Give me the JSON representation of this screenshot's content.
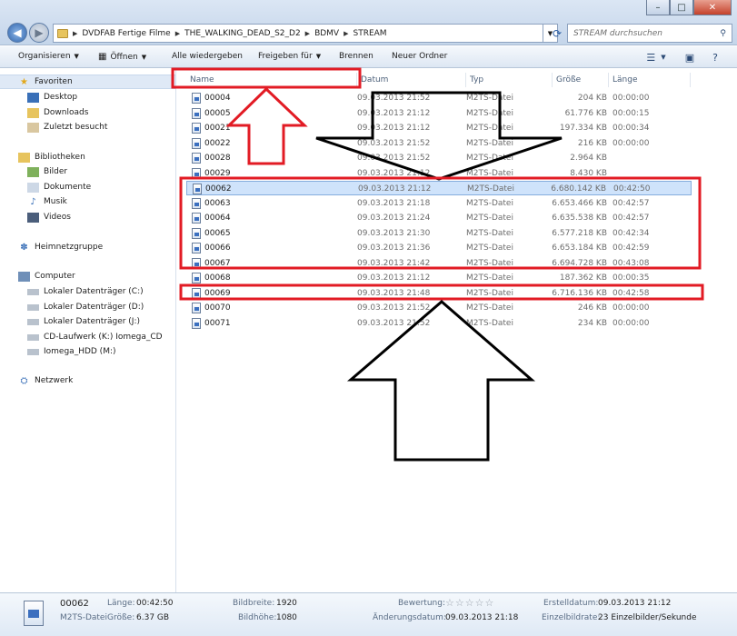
{
  "address": {
    "crumbs": [
      "DVDFAB Fertige Filme",
      "THE_WALKING_DEAD_S2_D2",
      "BDMV",
      "STREAM"
    ],
    "search_placeholder": "STREAM durchsuchen"
  },
  "toolbar": {
    "organize": "Organisieren",
    "open": "Öffnen",
    "play_all": "Alle wiedergeben",
    "share": "Freigeben für",
    "burn": "Brennen",
    "new_folder": "Neuer Ordner"
  },
  "nav": {
    "favorites": "Favoriten",
    "desktop": "Desktop",
    "downloads": "Downloads",
    "recent": "Zuletzt besucht",
    "libraries": "Bibliotheken",
    "pictures": "Bilder",
    "documents": "Dokumente",
    "music": "Musik",
    "videos": "Videos",
    "homegroup": "Heimnetzgruppe",
    "computer": "Computer",
    "drive_c": "Lokaler Datenträger (C:)",
    "drive_d": "Lokaler Datenträger (D:)",
    "drive_j": "Lokaler Datenträger (J:)",
    "drive_k": "CD-Laufwerk (K:) Iomega_CD",
    "drive_m": "Iomega_HDD (M:)",
    "network": "Netzwerk"
  },
  "columns": {
    "name": "Name",
    "date": "Datum",
    "type": "Typ",
    "size": "Größe",
    "length": "Länge"
  },
  "files": [
    {
      "name": "00004",
      "date": "09.03.2013 21:52",
      "type": "M2TS-Datei",
      "size": "204 KB",
      "length": "00:00:00"
    },
    {
      "name": "00005",
      "date": "09.03.2013 21:12",
      "type": "M2TS-Datei",
      "size": "61.776 KB",
      "length": "00:00:15"
    },
    {
      "name": "00021",
      "date": "09.03.2013 21:12",
      "type": "M2TS-Datei",
      "size": "197.334 KB",
      "length": "00:00:34"
    },
    {
      "name": "00022",
      "date": "09.03.2013 21:52",
      "type": "M2TS-Datei",
      "size": "216 KB",
      "length": "00:00:00"
    },
    {
      "name": "00028",
      "date": "09.03.2013 21:52",
      "type": "M2TS-Datei",
      "size": "2.964 KB",
      "length": ""
    },
    {
      "name": "00029",
      "date": "09.03.2013 21:12",
      "type": "M2TS-Datei",
      "size": "8.430 KB",
      "length": ""
    },
    {
      "name": "00062",
      "date": "09.03.2013 21:12",
      "type": "M2TS-Datei",
      "size": "6.680.142 KB",
      "length": "00:42:50"
    },
    {
      "name": "00063",
      "date": "09.03.2013 21:18",
      "type": "M2TS-Datei",
      "size": "6.653.466 KB",
      "length": "00:42:57"
    },
    {
      "name": "00064",
      "date": "09.03.2013 21:24",
      "type": "M2TS-Datei",
      "size": "6.635.538 KB",
      "length": "00:42:57"
    },
    {
      "name": "00065",
      "date": "09.03.2013 21:30",
      "type": "M2TS-Datei",
      "size": "6.577.218 KB",
      "length": "00:42:34"
    },
    {
      "name": "00066",
      "date": "09.03.2013 21:36",
      "type": "M2TS-Datei",
      "size": "6.653.184 KB",
      "length": "00:42:59"
    },
    {
      "name": "00067",
      "date": "09.03.2013 21:42",
      "type": "M2TS-Datei",
      "size": "6.694.728 KB",
      "length": "00:43:08"
    },
    {
      "name": "00068",
      "date": "09.03.2013 21:12",
      "type": "M2TS-Datei",
      "size": "187.362 KB",
      "length": "00:00:35"
    },
    {
      "name": "00069",
      "date": "09.03.2013 21:48",
      "type": "M2TS-Datei",
      "size": "6.716.136 KB",
      "length": "00:42:58"
    },
    {
      "name": "00070",
      "date": "09.03.2013 21:52",
      "type": "M2TS-Datei",
      "size": "246 KB",
      "length": "00:00:00"
    },
    {
      "name": "00071",
      "date": "09.03.2013 21:52",
      "type": "M2TS-Datei",
      "size": "234 KB",
      "length": "00:00:00"
    }
  ],
  "selected_index": 6,
  "details": {
    "name": "00062",
    "type": "M2TS-Datei",
    "length_label": "Länge:",
    "length_value": "00:42:50",
    "size_label": "Größe:",
    "size_value": "6.37 GB",
    "width_label": "Bildbreite:",
    "width_value": "1920",
    "height_label": "Bildhöhe:",
    "height_value": "1080",
    "rating_label": "Bewertung:",
    "modified_label": "Änderungsdatum:",
    "modified_value": "09.03.2013 21:18",
    "created_label": "Erstelldatum:",
    "created_value": "09.03.2013 21:12",
    "framerate_label": "Einzelbildrate:",
    "framerate_value": "23 Einzelbilder/Sekunde"
  },
  "colors": {
    "annotation_red": "#e21b24",
    "annotation_black": "#000000",
    "selection": "#cfe3fb"
  }
}
